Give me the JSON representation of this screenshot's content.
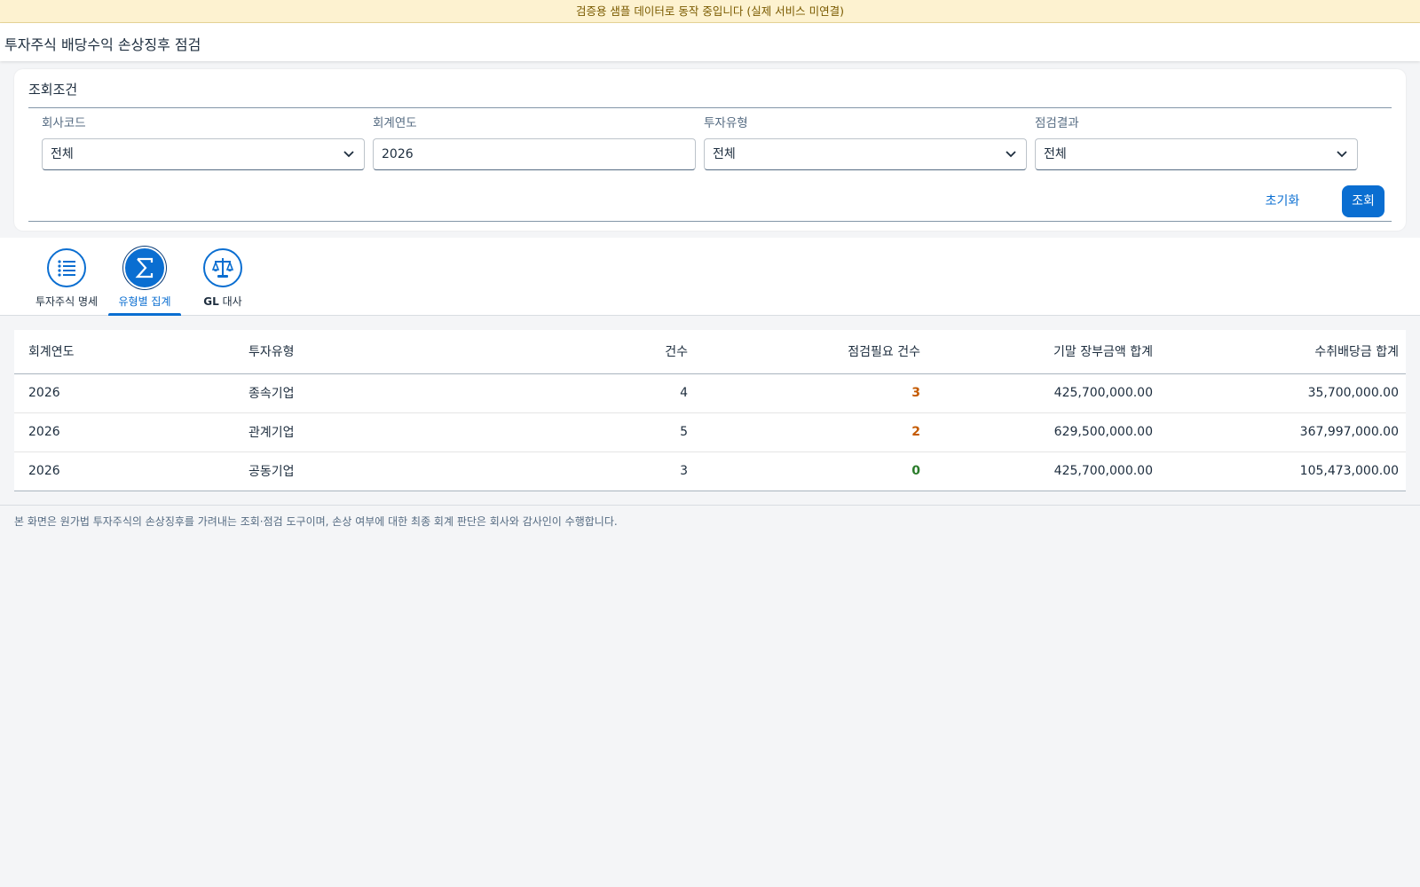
{
  "banner": "검증용 샘플 데이터로 동작 중입니다 (실제 서비스 미연결)",
  "header": {
    "title": "투자주식 배당수익 손상징후 점검"
  },
  "filters": {
    "title": "조회조건",
    "fields": [
      {
        "label": "회사코드",
        "value": "전체",
        "type": "select"
      },
      {
        "label": "회계연도",
        "value": "2026",
        "type": "input"
      },
      {
        "label": "투자유형",
        "value": "전체",
        "type": "select"
      },
      {
        "label": "점검결과",
        "value": "전체",
        "type": "select"
      }
    ],
    "reset_label": "초기화",
    "search_label": "조회"
  },
  "tabs": [
    {
      "label": "투자주식 명세",
      "icon": "list-icon",
      "active": false
    },
    {
      "label": "유형별 집계",
      "icon": "sigma-icon",
      "active": true
    },
    {
      "label_bold": "GL",
      "label_rest": " 대사",
      "icon": "scale-icon",
      "active": false
    }
  ],
  "table": {
    "columns": [
      "회계연도",
      "투자유형",
      "건수",
      "점검필요 건수",
      "기말 장부금액 합계",
      "수취배당금 합계"
    ],
    "rows": [
      {
        "year": "2026",
        "type": "종속기업",
        "count": "4",
        "check": "3",
        "book": "425,700,000.00",
        "dividend": "35,700,000.00",
        "check_status": "warning"
      },
      {
        "year": "2026",
        "type": "관계기업",
        "count": "5",
        "check": "2",
        "book": "629,500,000.00",
        "dividend": "367,997,000.00",
        "check_status": "warning"
      },
      {
        "year": "2026",
        "type": "공동기업",
        "count": "3",
        "check": "0",
        "book": "425,700,000.00",
        "dividend": "105,473,000.00",
        "check_status": "ok"
      }
    ]
  },
  "footnote": "본 화면은 원가법 투자주식의 손상징후를 가려내는 조회·점검 도구이며, 손상 여부에 대한 최종 회계 판단은 회사와 감사인이 수행합니다.",
  "colors": {
    "accent": "#0a6ed1",
    "warning": "#c45a00",
    "ok": "#2b7c2b",
    "banner_bg": "#fdf2d0"
  }
}
